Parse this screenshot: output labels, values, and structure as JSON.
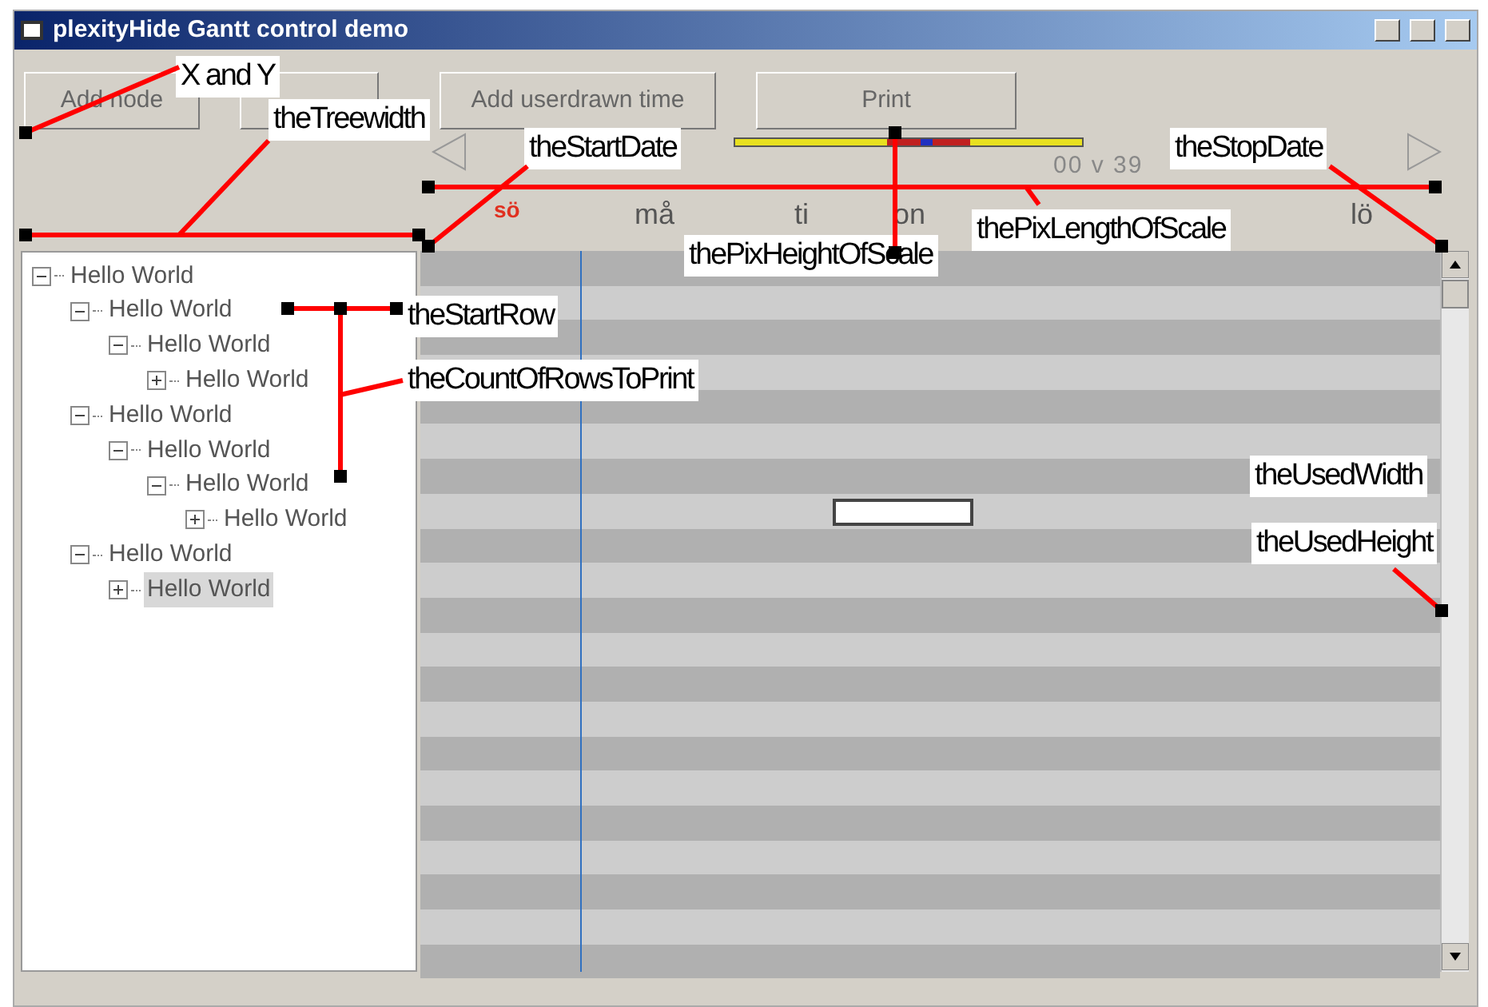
{
  "window": {
    "title": "plexityHide Gantt control demo"
  },
  "toolbar": {
    "buttons": [
      {
        "label": "Add node"
      },
      {
        "label": "Add userdrawn time"
      },
      {
        "label": "Print"
      }
    ]
  },
  "scale": {
    "week": "00 v 39",
    "days": [
      {
        "label": "sö",
        "color": "#e03020"
      },
      {
        "label": "må",
        "color": "#555555"
      },
      {
        "label": "ti",
        "color": "#555555"
      },
      {
        "label": "on",
        "color": "#555555"
      },
      {
        "label": "lö",
        "color": "#555555"
      }
    ]
  },
  "tree": [
    {
      "label": "Hello World",
      "expanded": true,
      "selected": false,
      "children": [
        {
          "label": "Hello World",
          "expanded": true,
          "selected": false,
          "children": [
            {
              "label": "Hello World",
              "expanded": true,
              "selected": false,
              "children": [
                {
                  "label": "Hello World",
                  "expanded": false,
                  "selected": false
                }
              ]
            }
          ]
        },
        {
          "label": "Hello World",
          "expanded": true,
          "selected": false,
          "children": [
            {
              "label": "Hello World",
              "expanded": true,
              "selected": false,
              "children": [
                {
                  "label": "Hello World",
                  "expanded": true,
                  "selected": false,
                  "children": [
                    {
                      "label": "Hello World",
                      "expanded": false,
                      "selected": false
                    }
                  ]
                }
              ]
            }
          ]
        },
        {
          "label": "Hello World",
          "expanded": true,
          "selected": false,
          "children": [
            {
              "label": "Hello World",
              "expanded": false,
              "selected": true
            }
          ]
        }
      ]
    }
  ],
  "annotations": [
    "X and Y",
    "theTreewidth",
    "theStartDate",
    "theStopDate",
    "thePixHeightOfScale",
    "thePixLengthOfScale",
    "theStartRow",
    "theCountOfRowsToPrint",
    "theUsedWidth",
    "theUsedHeight"
  ]
}
